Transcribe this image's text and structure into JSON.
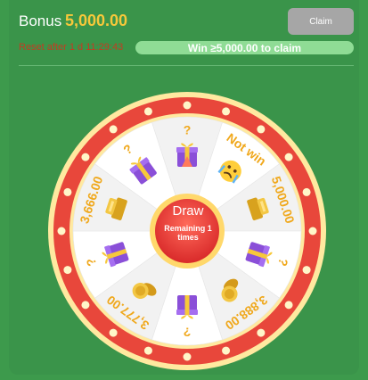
{
  "header": {
    "bonus_label": "Bonus",
    "bonus_value": "5,000.00",
    "claim_label": "Claim",
    "reset_text": "Reset after 1 d 11:29:43",
    "progress_label": "Win ≥5,000.00 to claim",
    "progress_fraction": 0.0
  },
  "wheel": {
    "draw_label": "Draw",
    "remaining_label": "Remaining 1 times",
    "segments": [
      {
        "label": "?",
        "icon": "purple-gift-icon"
      },
      {
        "label": "Not win",
        "icon": "crying-face-icon"
      },
      {
        "label": "5,000.00",
        "icon": "gold-bars-icon"
      },
      {
        "label": "?",
        "icon": "purple-gift-icon"
      },
      {
        "label": "3,888.00",
        "icon": "gold-coins-icon"
      },
      {
        "label": "?",
        "icon": "purple-gift-icon"
      },
      {
        "label": "3,777.00",
        "icon": "gold-coins-icon"
      },
      {
        "label": "?",
        "icon": "purple-gift-icon"
      },
      {
        "label": "3,666.00",
        "icon": "gold-bars-icon"
      },
      {
        "label": "?",
        "icon": "purple-gift-icon"
      }
    ]
  },
  "colors": {
    "background": "#3a944a",
    "accent": "#f7c83a",
    "wheel_rim": "#e8473b",
    "segment_label": "#f0a81c"
  }
}
